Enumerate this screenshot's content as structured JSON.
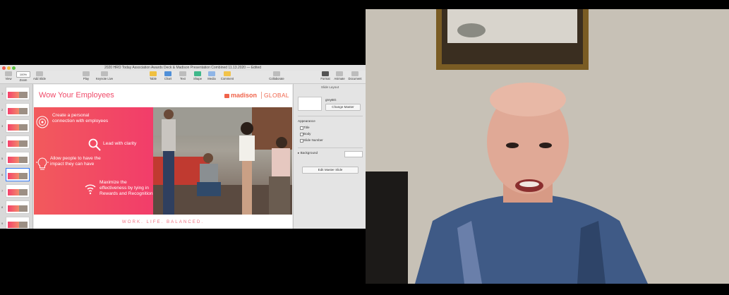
{
  "window": {
    "title": "2020 HRO Today Association Awards Deck & Madison Presentation Combined 11.13.2020 — Edited"
  },
  "toolbar": {
    "view": "View",
    "zoom_value": "100%",
    "zoom": "Zoom",
    "add_slide": "Add Slide",
    "play": "Play",
    "keynote_live": "Keynote Live",
    "table": "Table",
    "chart": "Chart",
    "text": "Text",
    "shape": "Shape",
    "media": "Media",
    "comment": "Comment",
    "collaborate": "Collaborate",
    "format": "Format",
    "animate": "Animate",
    "document": "Document"
  },
  "navigator": {
    "slide_numbers": [
      "1",
      "2",
      "3",
      "4",
      "5",
      "6",
      "7",
      "8",
      "9"
    ],
    "selected_index": 5
  },
  "slide": {
    "title": "Wow Your Employees",
    "logo_name": "madison",
    "logo_suffix": "GLOBAL",
    "points": [
      {
        "icon": "target-icon",
        "text": "Create a personal connection with employees"
      },
      {
        "icon": "magnifier-icon",
        "text": "Lead with clarity"
      },
      {
        "icon": "lightbulb-icon",
        "text": "Allow people to have the impact they can have"
      },
      {
        "icon": "signal-icon",
        "text": "Maximize the effectiveness by tying in Rewards and Recognition"
      }
    ],
    "footer": "WORK. LIFE. BALANCED.",
    "colors": {
      "accent": "#f04b6a",
      "gradient_start": "#f25a5c",
      "gradient_end": "#f23d6a"
    }
  },
  "inspector": {
    "header": "Slide Layout",
    "master_name": "greyBG",
    "change_master": "Change Master",
    "appearance": "Appearance",
    "options": [
      "Title",
      "Body",
      "Slide Number"
    ],
    "background": "Background",
    "edit_master": "Edit Master Slide"
  }
}
